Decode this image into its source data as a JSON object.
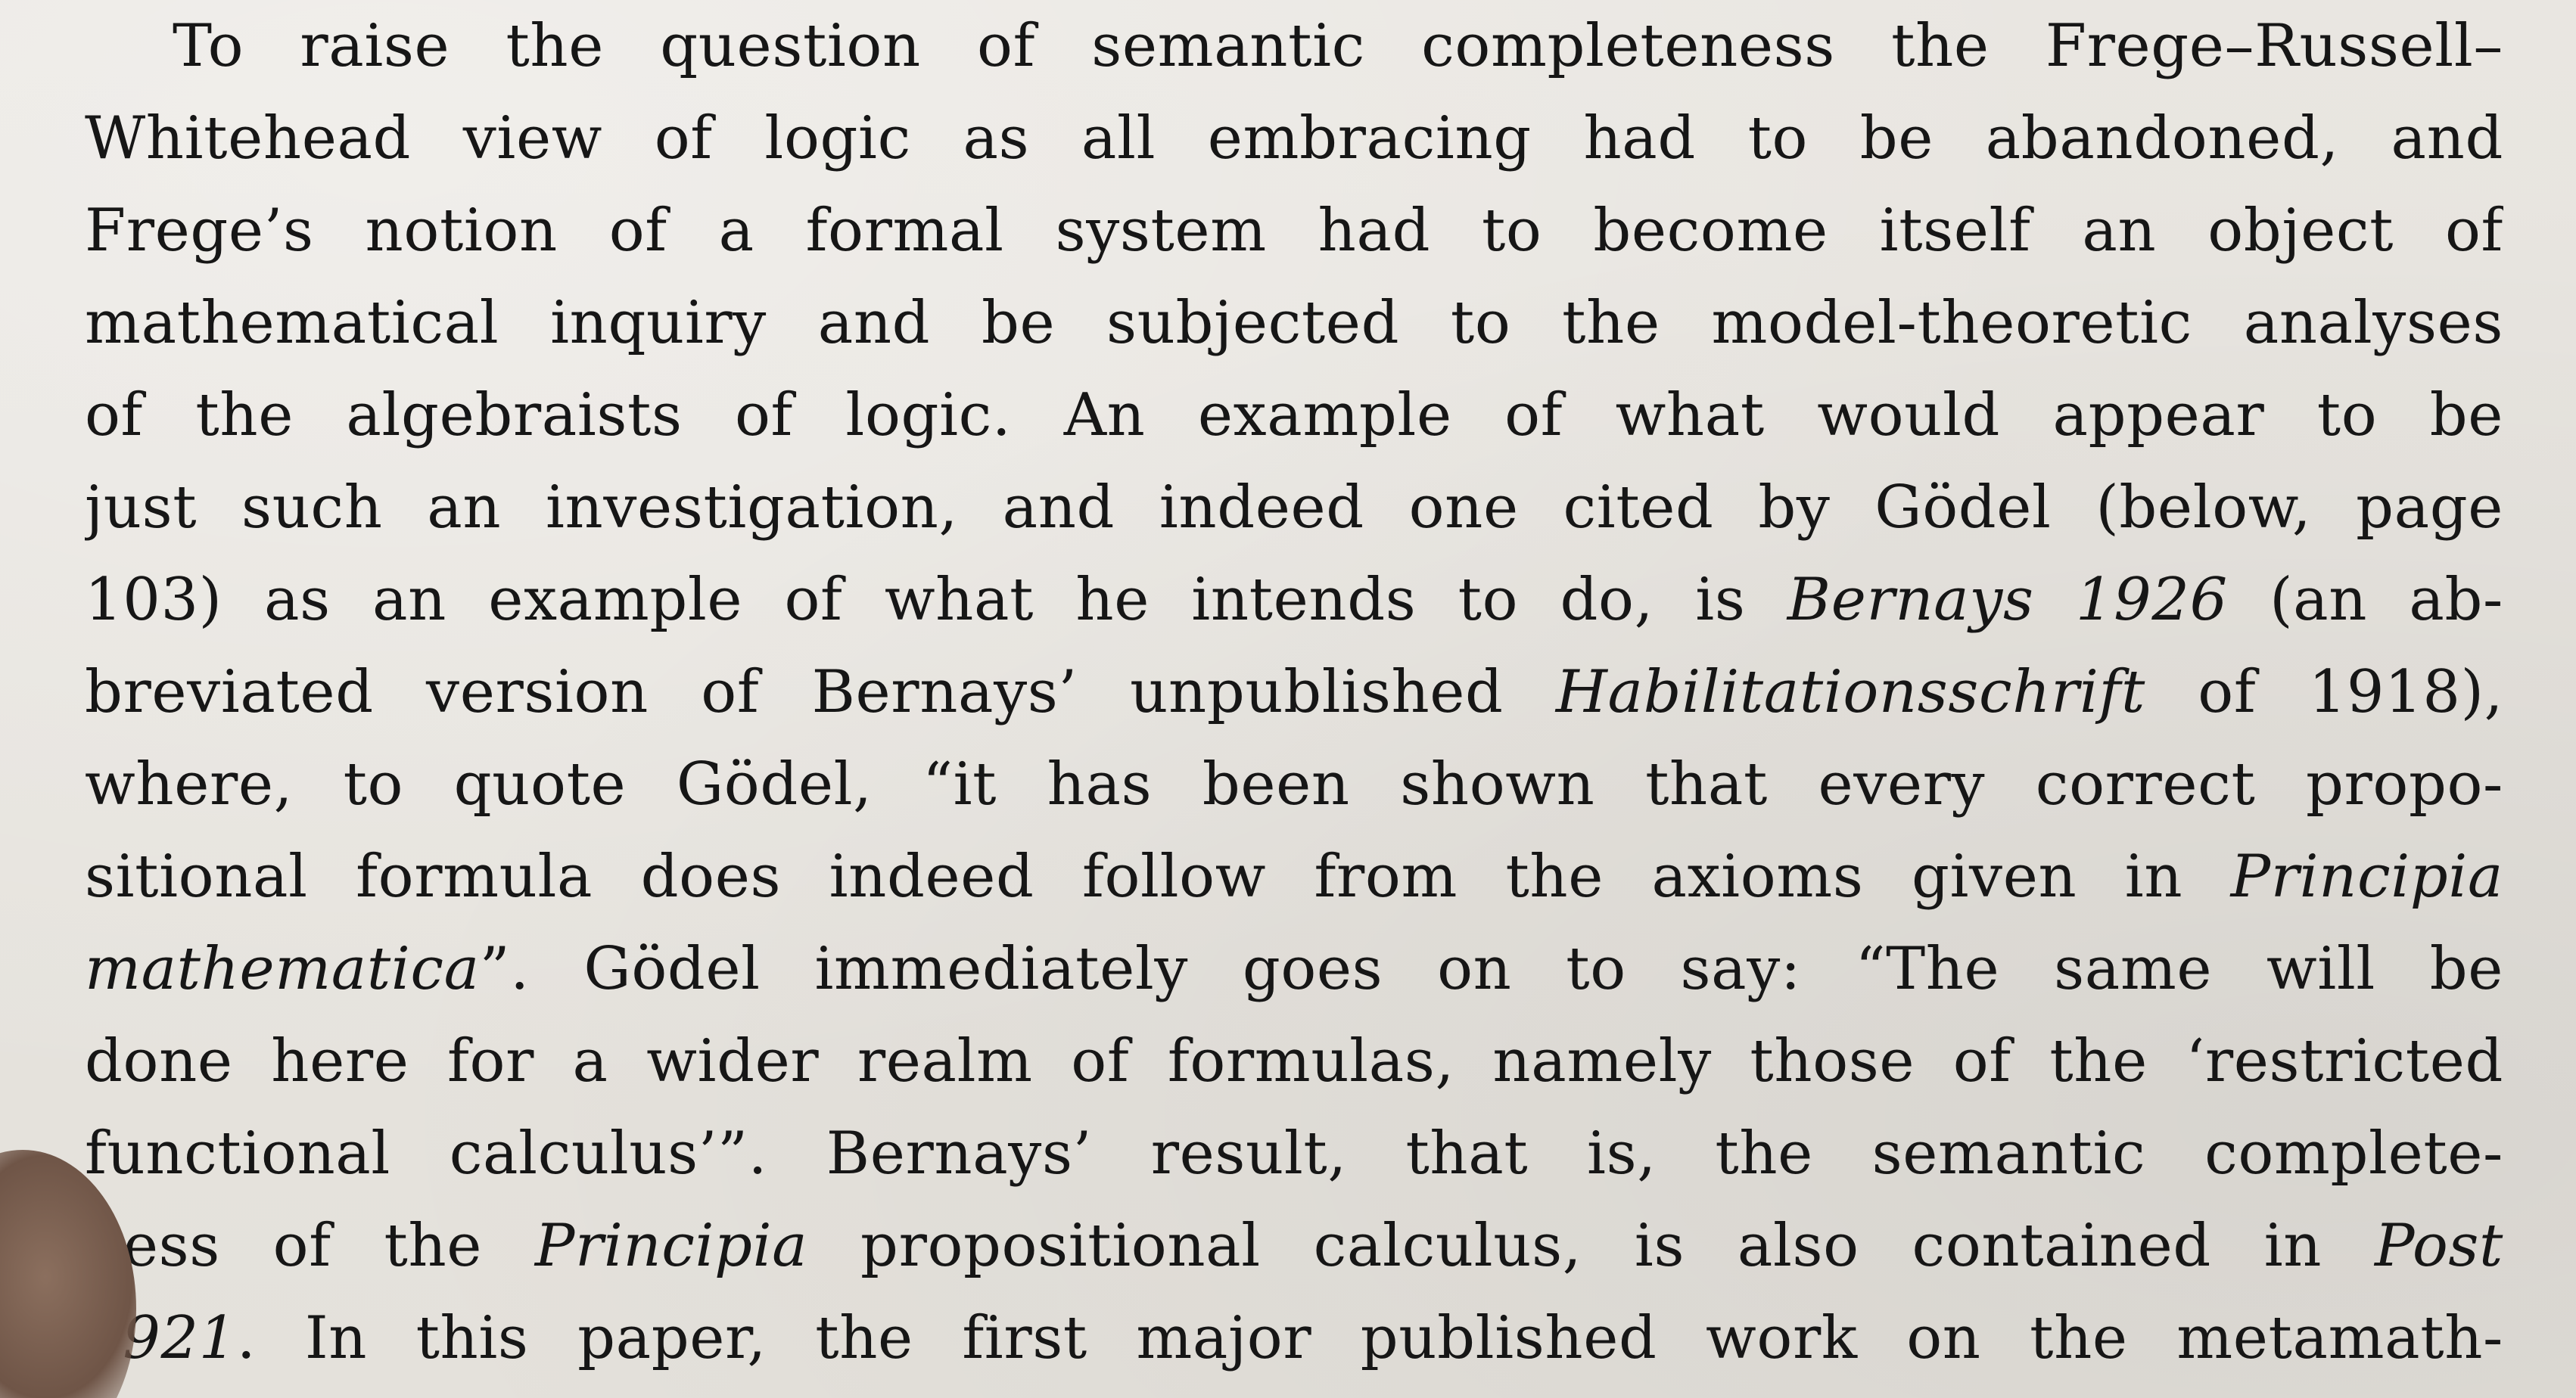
{
  "document": {
    "lines": [
      {
        "segments": [
          {
            "text": "To raise the question of semantic completeness the Frege–Russell–",
            "italic": false
          }
        ]
      },
      {
        "segments": [
          {
            "text": "Whitehead view of logic as all embracing had to be abandoned, and",
            "italic": false
          }
        ]
      },
      {
        "segments": [
          {
            "text": "Frege’s notion of a formal system had to become itself an object of",
            "italic": false
          }
        ]
      },
      {
        "segments": [
          {
            "text": "mathematical inquiry and be subjected to the model-theoretic analyses",
            "italic": false
          }
        ]
      },
      {
        "segments": [
          {
            "text": "of the algebraists of logic.  An example of what would appear to be",
            "italic": false
          }
        ]
      },
      {
        "segments": [
          {
            "text": "just such an investigation, and indeed one cited by Gödel (below, page",
            "italic": false
          }
        ]
      },
      {
        "segments": [
          {
            "text": "103) as an example of what he intends to do, is ",
            "italic": false
          },
          {
            "text": "Bernays 1926",
            "italic": true
          },
          {
            "text": " (an ab-",
            "italic": false
          }
        ]
      },
      {
        "segments": [
          {
            "text": "breviated version of Bernays’ unpublished ",
            "italic": false
          },
          {
            "text": "Habilitationsschrift",
            "italic": true
          },
          {
            "text": " of 1918),",
            "italic": false
          }
        ]
      },
      {
        "segments": [
          {
            "text": "where, to quote Gödel, “it has been shown that every correct propo-",
            "italic": false
          }
        ]
      },
      {
        "segments": [
          {
            "text": "sitional formula does indeed follow from the axioms given in ",
            "italic": false
          },
          {
            "text": "Principia",
            "italic": true
          }
        ]
      },
      {
        "segments": [
          {
            "text": "mathematica",
            "italic": true
          },
          {
            "text": "”. Gödel immediately goes on to say: “The same will be",
            "italic": false
          }
        ]
      },
      {
        "segments": [
          {
            "text": "done here for a wider realm of formulas, namely those of the ‘restricted",
            "italic": false
          }
        ]
      },
      {
        "segments": [
          {
            "text": "functional calculus’”. Bernays’ result, that is, the semantic complete-",
            "italic": false
          }
        ]
      },
      {
        "segments": [
          {
            "text": "ness of the ",
            "italic": false
          },
          {
            "text": "Principia",
            "italic": true
          },
          {
            "text": " propositional calculus, is also contained in ",
            "italic": false
          },
          {
            "text": "Post",
            "italic": true
          }
        ]
      },
      {
        "segments": [
          {
            "text": "1921",
            "italic": true
          },
          {
            "text": ". In this paper, the first major published work on the metamath-",
            "italic": false
          }
        ]
      }
    ]
  }
}
